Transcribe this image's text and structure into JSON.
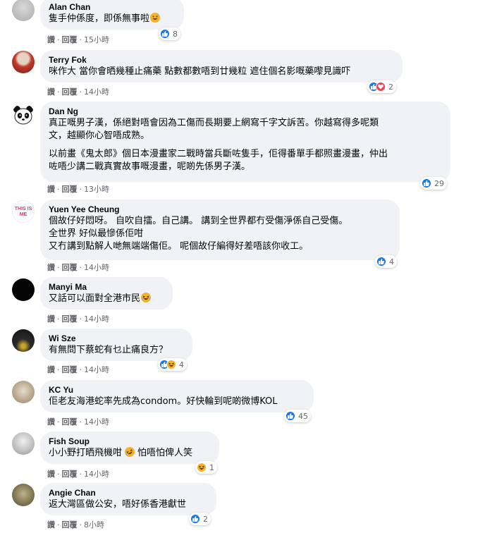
{
  "actions": {
    "like": "讚",
    "reply": "回覆"
  },
  "colors": {
    "bubble_bg": "#f0f2f5",
    "like_blue": "#1877f2",
    "love_red": "#f33e58",
    "haha_yellow": "#f7b125",
    "meta_gray": "#65676b"
  },
  "comments": [
    {
      "name": "Alan Chan",
      "lines": [
        "隻手仲係度，即係無事啦"
      ],
      "time": "15小時",
      "reactions": [
        "like"
      ],
      "count": "8",
      "avatar": "gray-photo-avatar",
      "inline_emoji": "sweat-smile-emoji"
    },
    {
      "name": "Terry Fok",
      "lines": [
        "咪作大 當你會晒幾種止痛藥 點數都數唔到廿幾粒 遮住個名影嘅藥嚟見識吓"
      ],
      "time": "14小時",
      "reactions": [
        "like",
        "love"
      ],
      "count": "2",
      "avatar": "red-photo-avatar"
    },
    {
      "name": "Dan Ng",
      "paragraphs": [
        [
          "真正嘅男子漢，係絕對唔會因為工傷而長期要上網寫千字文訴苦。你越寫得多呢類",
          "文，越顯你心智唔成熟。"
        ],
        [
          "以前畫《鬼太郎》個日本漫畫家二戰時當兵斷咗隻手，佢得番單手都照畫漫畫，仲出",
          "咗唔少講二戰真實故事嘅漫畫，呢啲先係男子漢。"
        ]
      ],
      "time": "13小時",
      "reactions": [
        "like"
      ],
      "count": "29",
      "avatar": "panda-avatar"
    },
    {
      "name": "Yuen Yee Cheung",
      "lines": [
        "個故仔好悶呀。 自吹自擂。自己講。 講到全世界都冇受傷淨係自己受傷。",
        "全世界 好似最慘係佢咁",
        "又冇講到點解人哋無端端傷佢。 呢個故仔編得好差唔該你收工。"
      ],
      "time": "14小時",
      "reactions": [
        "like"
      ],
      "count": "4",
      "avatar": "this-is-me-avatar",
      "avatar_text": "THIS IS ME"
    },
    {
      "name": "Manyi Ma",
      "lines": [
        "又話可以面對全港市民"
      ],
      "time": "14小時",
      "reactions": [],
      "count": "",
      "avatar": "black-avatar",
      "inline_emoji": "laughing-tears-emoji"
    },
    {
      "name": "Wi Sze",
      "lines": [
        "有無問下蔡蛇有乜止痛良方？"
      ],
      "time": "14小時",
      "reactions": [
        "like",
        "haha"
      ],
      "count": "4",
      "avatar": "dark-photo-avatar"
    },
    {
      "name": "KC Yu",
      "lines": [
        "佢老友海港蛇率先成為condom。好快輪到呢啲微博KOL"
      ],
      "time": "14小時",
      "reactions": [
        "like"
      ],
      "count": "45",
      "avatar": "beige-photo-avatar"
    },
    {
      "name": "Fish Soup",
      "lines": [
        "小小野打晒飛機咁",
        "怕唔怕俾人笑"
      ],
      "time": "14小時",
      "reactions": [
        "haha"
      ],
      "count": "1",
      "avatar": "gray-photo-avatar-2",
      "inline_emoji": "rofl-emoji"
    },
    {
      "name": "Angie Chan",
      "lines": [
        "返大灣區做公安，唔好係香港獻世"
      ],
      "time": "8小時",
      "reactions": [
        "like"
      ],
      "count": "2",
      "avatar": "olive-photo-avatar"
    }
  ]
}
